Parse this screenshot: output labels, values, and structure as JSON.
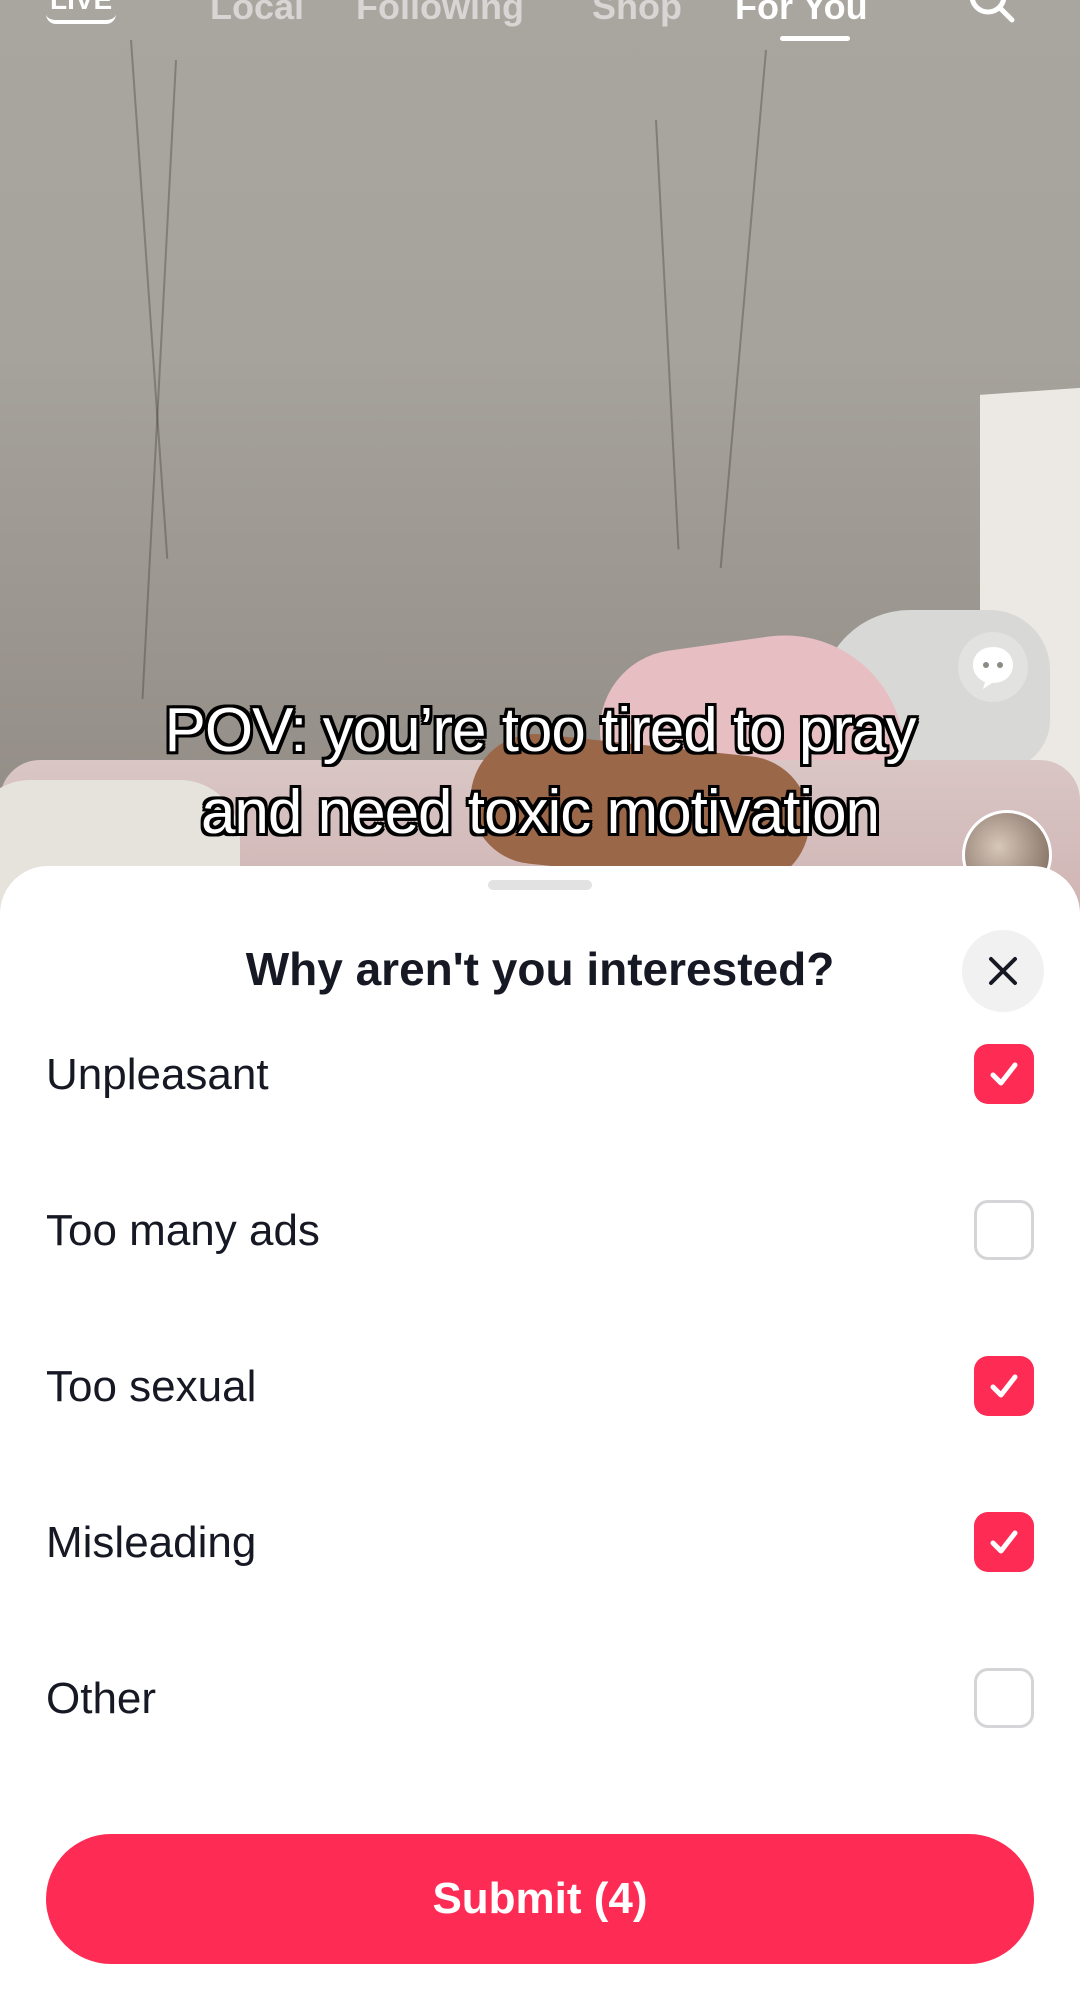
{
  "top_nav": {
    "live_label": "LIVE",
    "tabs": [
      "Local",
      "Following",
      "Shop",
      "For You"
    ],
    "active_tab": "For You",
    "search_icon": "search-icon"
  },
  "video": {
    "caption_line_1": "POV: you’re too tired to pray",
    "caption_line_2": "and need toxic motivation"
  },
  "sheet": {
    "title": "Why aren't you interested?",
    "close_icon": "close-icon",
    "options": [
      {
        "label": "Unpleasant",
        "checked": true
      },
      {
        "label": "Too many ads",
        "checked": false
      },
      {
        "label": "Too sexual",
        "checked": true
      },
      {
        "label": "Misleading",
        "checked": true
      },
      {
        "label": "Other",
        "checked": false
      }
    ],
    "submit_label": "Submit (4)"
  },
  "colors": {
    "accent": "#fe2c55",
    "text": "#161823"
  }
}
